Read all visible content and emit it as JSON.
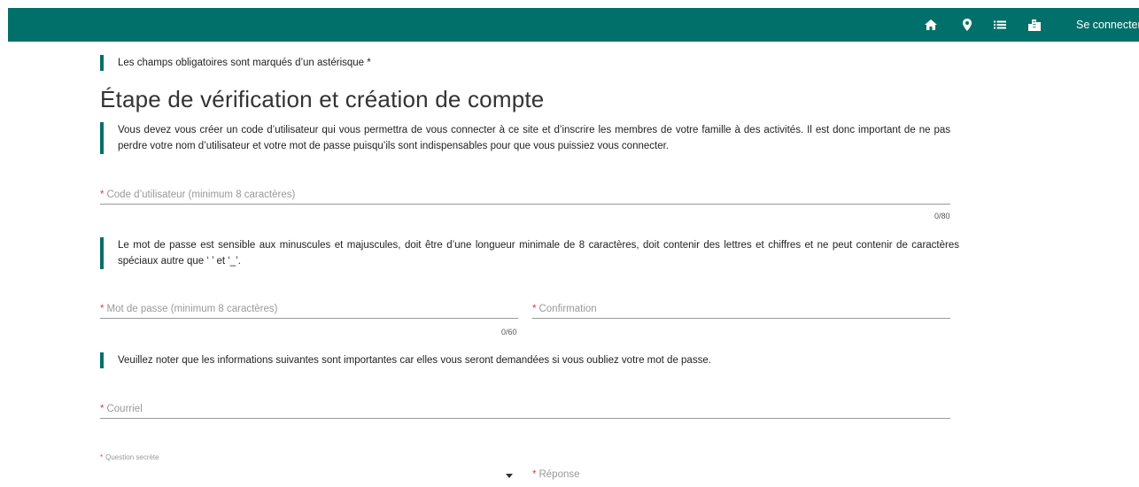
{
  "navbar": {
    "bg_color": "#02706a",
    "icons": [
      "home-icon",
      "location-pin-icon",
      "list-icon",
      "building-icon"
    ],
    "login_label": "Se connecter"
  },
  "required_note": "Les champs obligatoires sont marqués d’un astérisque *",
  "page_title": "Étape de vérification et création de compte",
  "intro_note": "Vous devez vous créer un code d’utilisateur qui vous permettra de vous connecter à ce site et d’inscrire les membres de votre famille à des activités. Il est donc important de ne pas perdre votre nom d’utilisateur et votre mot de passe puisqu’ils sont indispensables pour que vous puissiez vous connecter.",
  "username": {
    "required_mark": "*",
    "placeholder": "Code d’utilisateur (minimum 8 caractères)",
    "counter": "0/80"
  },
  "password_note": "Le mot de passe est sensible aux minuscules et majuscules, doit être d’une longueur minimale de 8 caractères, doit contenir des lettres et chiffres et ne peut contenir de caractères spéciaux autre que ‘ ’ et ‘_’.",
  "password": {
    "required_mark": "*",
    "placeholder": "Mot de passe (minimum 8 caractères)",
    "counter": "0/60"
  },
  "confirmation": {
    "required_mark": "*",
    "placeholder": "Confirmation"
  },
  "recovery_note": "Veuillez noter que les informations suivantes sont importantes car elles vous seront demandées si vous oubliez votre mot de passe.",
  "email": {
    "required_mark": "*",
    "placeholder": "Courriel"
  },
  "secret_question": {
    "required_mark": "*",
    "label": "Question secrète",
    "selected": ""
  },
  "answer": {
    "required_mark": "*",
    "placeholder": "Réponse"
  },
  "accent_color": "#02706a",
  "required_color": "#e53935"
}
